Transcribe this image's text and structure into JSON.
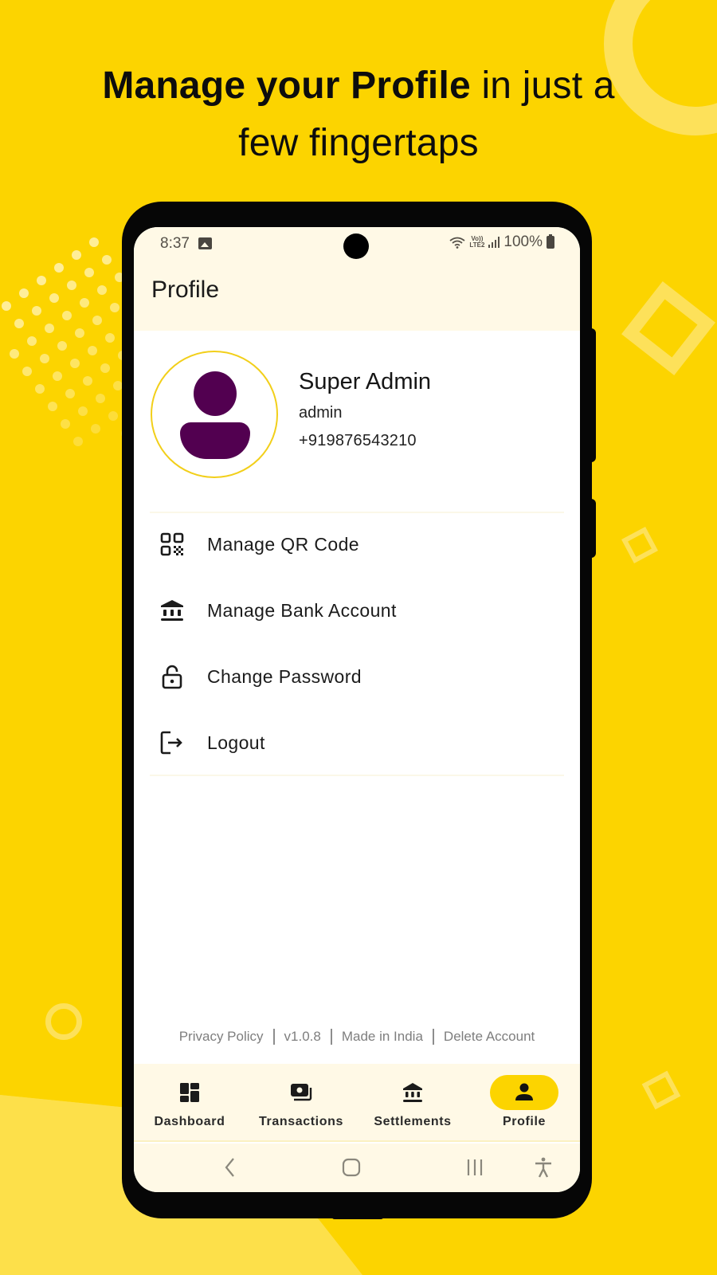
{
  "headline": {
    "bold": "Manage your Profile",
    "light_line1": " in just a",
    "line2": "few fingertaps"
  },
  "status_bar": {
    "time": "8:37",
    "network_top": "Vo))",
    "network_bottom": "LTE2",
    "battery": "100%",
    "icons": [
      "gallery-icon",
      "wifi-icon",
      "volte-icon",
      "signal-icon",
      "battery-icon"
    ]
  },
  "app": {
    "title": "Profile",
    "profile": {
      "name": "Super Admin",
      "role": "admin",
      "phone": "+919876543210"
    },
    "menu": [
      {
        "label": "Manage QR Code",
        "icon": "qr-code-icon"
      },
      {
        "label": "Manage Bank Account",
        "icon": "bank-icon"
      },
      {
        "label": "Change Password",
        "icon": "unlock-icon"
      },
      {
        "label": "Logout",
        "icon": "logout-icon"
      }
    ],
    "footer": {
      "privacy": "Privacy Policy",
      "version": "v1.0.8",
      "made_in": "Made in India",
      "delete": "Delete Account"
    },
    "bottom_nav": [
      {
        "label": "Dashboard",
        "icon": "dashboard-icon",
        "active": false
      },
      {
        "label": "Transactions",
        "icon": "transactions-icon",
        "active": false
      },
      {
        "label": "Settlements",
        "icon": "bank-icon",
        "active": false
      },
      {
        "label": "Profile",
        "icon": "person-icon",
        "active": true
      }
    ]
  },
  "colors": {
    "background": "#FCD400",
    "accent": "#FCD400",
    "avatar": "#520050",
    "header_bg": "#FFF9E6"
  }
}
